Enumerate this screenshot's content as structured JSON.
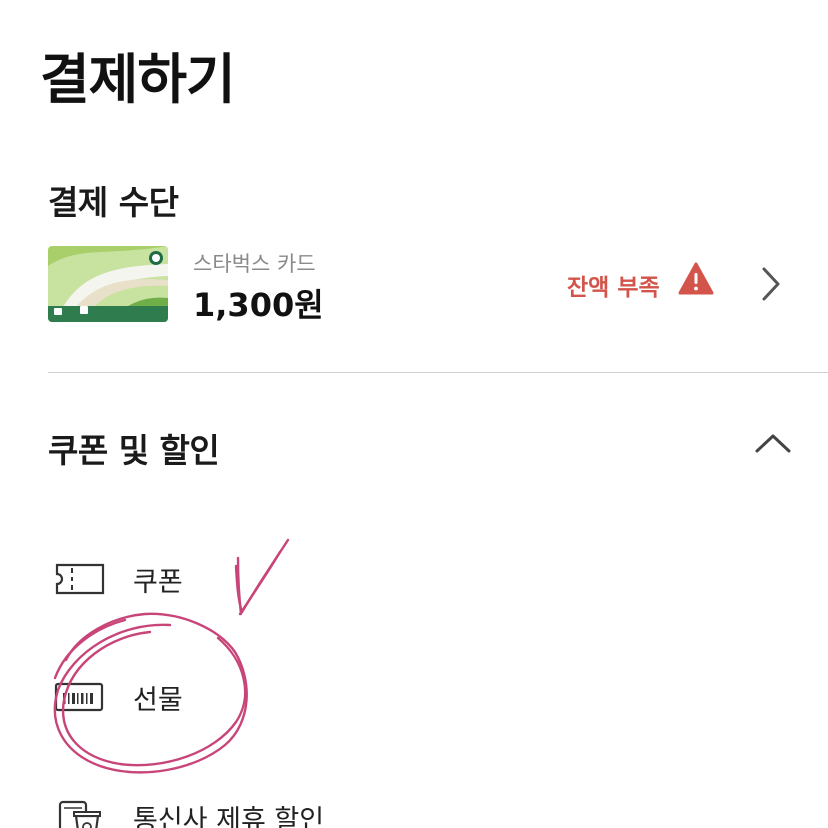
{
  "page": {
    "title": "결제하기"
  },
  "payment_method": {
    "section_title": "결제 수단",
    "card": {
      "name": "스타벅스 카드",
      "balance": "1,300원",
      "warning": "잔액 부족",
      "warning_color": "#d2544a"
    }
  },
  "coupons": {
    "section_title": "쿠폰 및 할인",
    "items": [
      {
        "label": "쿠폰",
        "icon": "coupon-ticket-icon"
      },
      {
        "label": "선물",
        "icon": "gift-card-icon"
      },
      {
        "label": "통신사 제휴 할인",
        "icon": "phone-cup-icon"
      }
    ]
  },
  "colors": {
    "annotation": "#c8457a",
    "brand_green": "#2f7d4f"
  }
}
